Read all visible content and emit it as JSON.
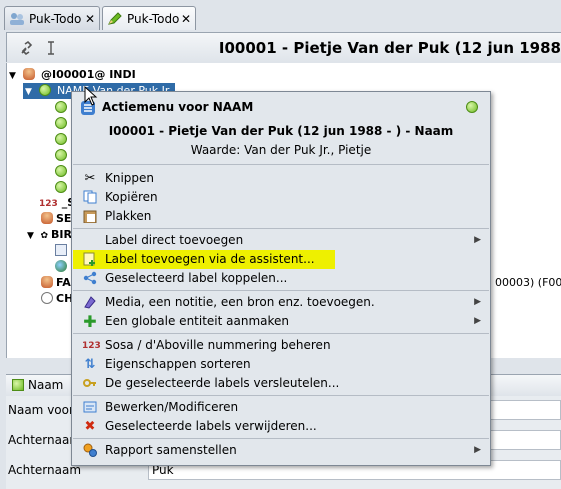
{
  "tabs": [
    {
      "label": "Puk-Todo",
      "close": "✕",
      "icon": "people-icon"
    },
    {
      "label": "Puk-Todo",
      "close": "✕",
      "icon": "pencil-icon"
    }
  ],
  "toolbar": {
    "title": "I00001 - Pietje Van der Puk (12 jun 1988"
  },
  "tree": {
    "root": "@I00001@ INDI",
    "selected": "NAME Van der Puk Jr., Pietje",
    "rows": [
      {
        "text": "_S"
      },
      {
        "text": "SE"
      },
      {
        "text": "BIR"
      },
      {
        "text": "FA",
        "suffix": "00003) (F00"
      },
      {
        "text": "CH"
      }
    ]
  },
  "panel": {
    "title": "Naam",
    "fields": [
      {
        "label": "Naam voor",
        "value": ""
      },
      {
        "label": "Achternaam",
        "value": ""
      },
      {
        "label": "Achternaam",
        "value": "Puk"
      }
    ]
  },
  "menu": {
    "title": "Actiemenu voor NAAM",
    "subtitle": "I00001 - Pietje Van der Puk (12 jun 1988 - ) - Naam",
    "value_line": "Waarde: Van der Puk Jr., Pietje",
    "items": {
      "cut": "Knippen",
      "copy": "Kopiëren",
      "paste": "Plakken",
      "add_direct": "Label direct toevoegen",
      "add_assistant": "Label toevoegen via de assistent...",
      "link_selected": "Geselecteerd label koppelen...",
      "media": "Media, een notitie, een bron enz. toevoegen.",
      "global_entity": "Een globale entiteit aanmaken",
      "sosa": "Sosa / d'Aboville nummering beheren",
      "sort": "Eigenschappen sorteren",
      "encrypt": "De geselecteerde labels versleutelen...",
      "edit": "Bewerken/Modificeren",
      "delete": "Geselecteerde labels verwijderen...",
      "report": "Rapport samenstellen"
    },
    "highlight_color": "#eef000",
    "selection_color": "#2f6ba7"
  }
}
